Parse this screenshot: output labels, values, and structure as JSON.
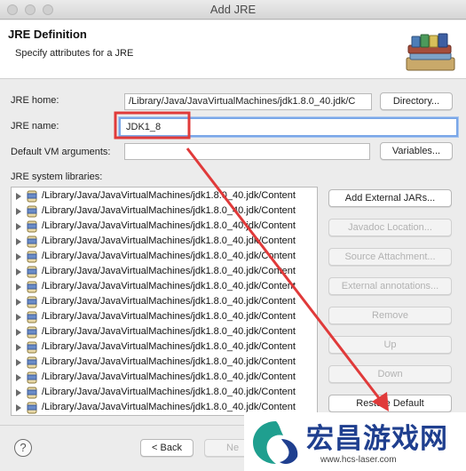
{
  "window": {
    "title": "Add JRE"
  },
  "header": {
    "title": "JRE Definition",
    "subtitle": "Specify attributes for a JRE",
    "icon": "books-icon"
  },
  "form": {
    "jre_home_label": "JRE home:",
    "jre_home_value": "/Library/Java/JavaVirtualMachines/jdk1.8.0_40.jdk/C",
    "directory_button": "Directory...",
    "jre_name_label": "JRE name:",
    "jre_name_value": "JDK1_8",
    "vm_args_label": "Default VM arguments:",
    "vm_args_value": "",
    "variables_button": "Variables...",
    "libraries_label": "JRE system libraries:"
  },
  "libraries": [
    "/Library/Java/JavaVirtualMachines/jdk1.8.0_40.jdk/Content",
    "/Library/Java/JavaVirtualMachines/jdk1.8.0_40.jdk/Content",
    "/Library/Java/JavaVirtualMachines/jdk1.8.0_40.jdk/Content",
    "/Library/Java/JavaVirtualMachines/jdk1.8.0_40.jdk/Content",
    "/Library/Java/JavaVirtualMachines/jdk1.8.0_40.jdk/Content",
    "/Library/Java/JavaVirtualMachines/jdk1.8.0_40.jdk/Content",
    "/Library/Java/JavaVirtualMachines/jdk1.8.0_40.jdk/Content",
    "/Library/Java/JavaVirtualMachines/jdk1.8.0_40.jdk/Content",
    "/Library/Java/JavaVirtualMachines/jdk1.8.0_40.jdk/Content",
    "/Library/Java/JavaVirtualMachines/jdk1.8.0_40.jdk/Content",
    "/Library/Java/JavaVirtualMachines/jdk1.8.0_40.jdk/Content",
    "/Library/Java/JavaVirtualMachines/jdk1.8.0_40.jdk/Content",
    "/Library/Java/JavaVirtualMachines/jdk1.8.0_40.jdk/Content",
    "/Library/Java/JavaVirtualMachines/jdk1.8.0_40.jdk/Content",
    "/Library/Java/JavaVirtualMachines/jdk1.8.0_40.jdk/Content"
  ],
  "library_buttons": {
    "add_external": "Add External JARs...",
    "javadoc": "Javadoc Location...",
    "source": "Source Attachment...",
    "external_annotations": "External annotations...",
    "remove": "Remove",
    "up": "Up",
    "down": "Down",
    "restore": "Restore Default"
  },
  "footer": {
    "help": "?",
    "back": "< Back",
    "next": "Ne"
  },
  "watermark": {
    "text": "宏昌游戏网",
    "url": "www.hcs-laser.com"
  },
  "colors": {
    "annotation": "#e03a3a",
    "focus": "#7aa7e8",
    "watermark": "#1f3f8f"
  }
}
